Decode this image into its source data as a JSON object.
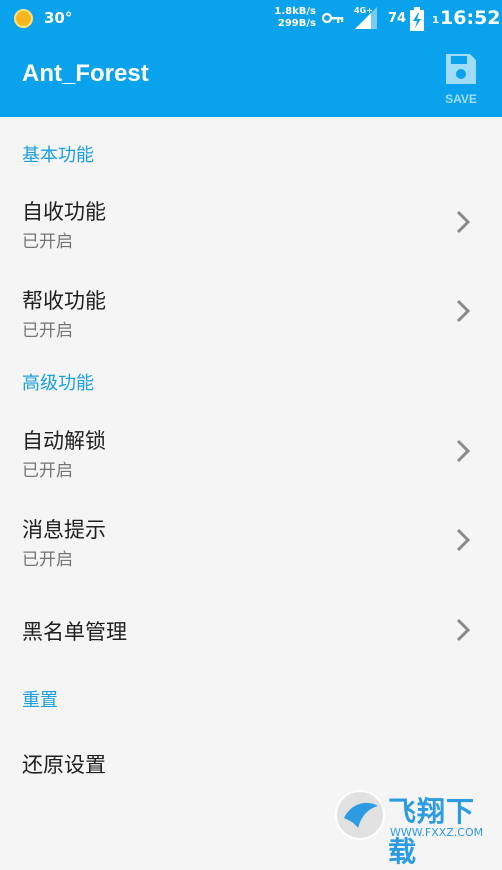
{
  "status_bar": {
    "temperature": "30°",
    "speed_up": "1.8kB/s",
    "speed_down": "299B/s",
    "network": "4G+",
    "battery": "74",
    "sim": "1",
    "time": "16:52"
  },
  "app_bar": {
    "title": "Ant_Forest",
    "save_label": "SAVE"
  },
  "sections": {
    "basic": "基本功能",
    "advanced": "高级功能",
    "reset": "重置"
  },
  "items": {
    "auto_collect": {
      "title": "自收功能",
      "summary": "已开启"
    },
    "help_collect": {
      "title": "帮收功能",
      "summary": "已开启"
    },
    "auto_unlock": {
      "title": "自动解锁",
      "summary": "已开启"
    },
    "message_notify": {
      "title": "消息提示",
      "summary": "已开启"
    },
    "blacklist": {
      "title": "黑名单管理"
    },
    "restore": {
      "title": "还原设置"
    }
  },
  "watermark": {
    "text": "飞翔下载",
    "url": "WWW.FXXZ.COM"
  },
  "colors": {
    "primary": "#0AA2EC",
    "accent": "#1AA0E0",
    "background": "#F5F5F5"
  }
}
